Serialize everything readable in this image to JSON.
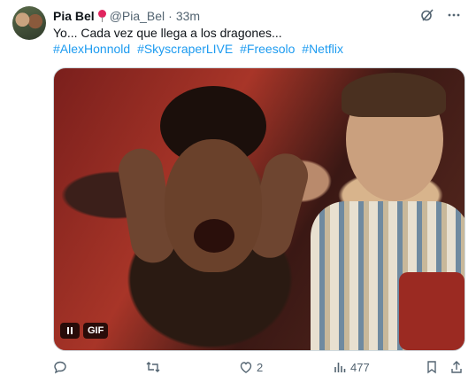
{
  "tweet": {
    "author_name": "Pia Bel",
    "author_handle": "@Pia_Bel",
    "separator": "·",
    "time": "33m",
    "text": "Yo... Cada vez que llega a los dragones...",
    "hashtags": [
      "#AlexHonnold",
      "#SkyscraperLIVE",
      "#Freesolo",
      "#Netflix"
    ]
  },
  "media": {
    "badge": "GIF"
  },
  "actions": {
    "replies": "",
    "retweets": "",
    "likes": "2",
    "views": "477"
  },
  "colors": {
    "link": "#1d9bf0",
    "muted": "#536471",
    "text": "#0f1419",
    "heart": "#e0245e"
  },
  "icons": {
    "grok": "grok-icon",
    "more": "more-icon",
    "reply": "reply-icon",
    "retweet": "retweet-icon",
    "like": "heart-icon",
    "views": "views-icon",
    "bookmark": "bookmark-icon",
    "share": "share-icon"
  }
}
